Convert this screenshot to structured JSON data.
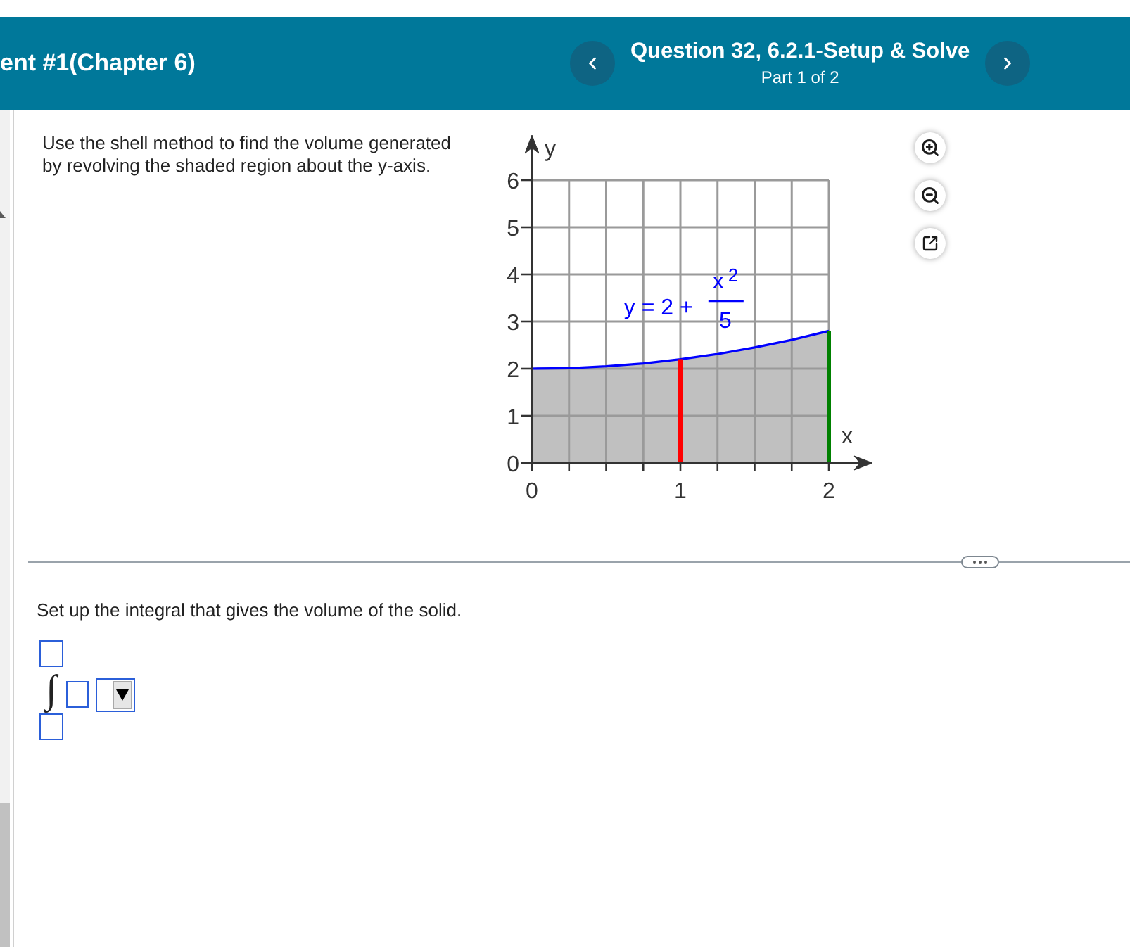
{
  "header": {
    "assignment_title": "ent #1(Chapter 6)",
    "question_title": "Question 32, 6.2.1-Setup & Solve",
    "part_label": "Part 1 of 2"
  },
  "question": {
    "prompt": "Use the shell method to find the volume generated by revolving the shaded region about the y-axis.",
    "graph": {
      "equation_label": {
        "text": "y = 2 +",
        "numerator": "x",
        "exponent": "2",
        "denominator": "5"
      },
      "chart_data": {
        "type": "area",
        "xlabel": "x",
        "ylabel": "y",
        "x": [
          0,
          0.25,
          0.5,
          0.75,
          1,
          1.25,
          1.5,
          1.75,
          2
        ],
        "series": [
          {
            "color": "#0000ff",
            "values": [
              2,
              2.01,
              2.05,
              2.11,
              2.2,
              2.31,
              2.45,
              2.61,
              2.8
            ]
          }
        ],
        "xlim": [
          0,
          2
        ],
        "ylim": [
          0,
          6
        ],
        "xticks": [
          0,
          1,
          2
        ],
        "yticks": [
          0,
          1,
          2,
          3,
          4,
          5,
          6
        ],
        "grid": true,
        "ref_lines": [
          {
            "axis": "x",
            "value": 1,
            "color": "#ff0000"
          },
          {
            "axis": "x",
            "value": 2,
            "color": "#008000"
          }
        ]
      }
    }
  },
  "part": {
    "prompt": "Set up the integral that gives the volume of the solid.",
    "integral_sign": "∫"
  }
}
